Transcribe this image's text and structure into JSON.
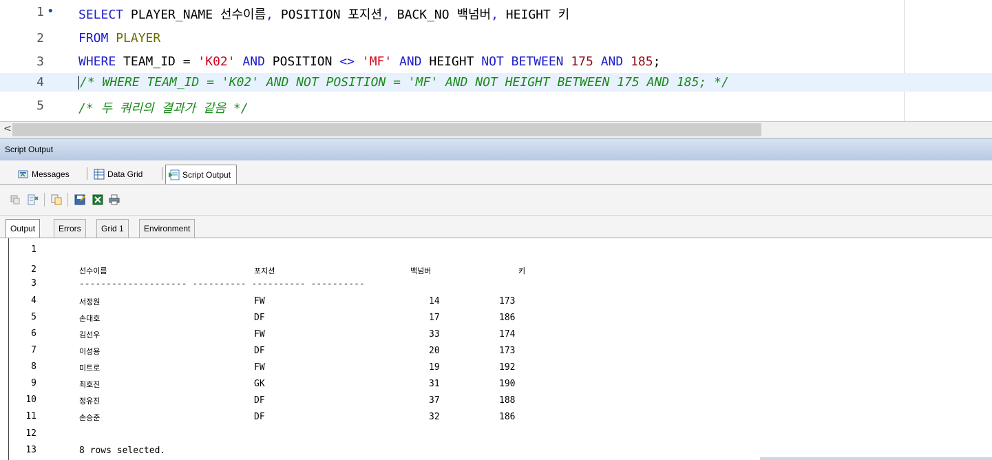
{
  "editor": {
    "lines": [
      {
        "num": "1",
        "marker": "•"
      },
      {
        "num": "2"
      },
      {
        "num": "3"
      },
      {
        "num": "4"
      },
      {
        "num": "5"
      }
    ],
    "line1": {
      "t1": "SELECT",
      "t2": " PLAYER_NAME 선수이름",
      "t3": ",",
      "t4": " POSITION 포지션",
      "t5": ",",
      "t6": " BACK_NO 백넘버",
      "t7": ",",
      "t8": " HEIGHT 키"
    },
    "line2": {
      "t1": "FROM",
      "t2": " PLAYER"
    },
    "line3": {
      "t1": "WHERE",
      "t2": " TEAM_ID = ",
      "t3": "'K02'",
      "t4": " AND",
      "t5": " POSITION ",
      "t6": "<>",
      "t7": " ",
      "t8": "'MF'",
      "t9": " AND",
      "t10": " HEIGHT ",
      "t11": "NOT BETWEEN",
      "t12": " ",
      "t13": "175",
      "t14": " AND",
      "t15": " ",
      "t16": "185",
      "t17": ";"
    },
    "line4": "/* WHERE TEAM_ID = 'K02' AND NOT POSITION = 'MF' AND NOT HEIGHT BETWEEN 175 AND 185; */",
    "line5": "/* 두 쿼리의 결과가 같음 */"
  },
  "scroll_left_arrow": "<",
  "panel": {
    "title": "Script Output"
  },
  "result_tabs": [
    {
      "label": "Messages",
      "icon": "messages-icon"
    },
    {
      "label": "Data Grid",
      "icon": "data-grid-icon"
    },
    {
      "label": "Script Output",
      "icon": "script-output-icon",
      "active": true
    }
  ],
  "toolbar_icons": [
    "pin-icon",
    "clear-icon",
    "copy-icon",
    "save-icon",
    "excel-icon",
    "print-icon"
  ],
  "output_tabs": [
    {
      "label": "Output",
      "active": true
    },
    {
      "label": "Errors"
    },
    {
      "label": "Grid 1"
    },
    {
      "label": "Environment"
    }
  ],
  "output": {
    "line_numbers": [
      "1",
      "2",
      "3",
      "4",
      "5",
      "6",
      "7",
      "8",
      "9",
      "10",
      "11",
      "12",
      "13"
    ],
    "headers": {
      "name": "선수이름",
      "position": "포지션",
      "back_no": "백넘버",
      "height": "키"
    },
    "separator": "-------------------- ---------- ---------- ----------",
    "rows": [
      {
        "name": "서정원",
        "position": "FW",
        "back_no": "14",
        "height": "173"
      },
      {
        "name": "손대호",
        "position": "DF",
        "back_no": "17",
        "height": "186"
      },
      {
        "name": "김선우",
        "position": "FW",
        "back_no": "33",
        "height": "174"
      },
      {
        "name": "이성용",
        "position": "DF",
        "back_no": "20",
        "height": "173"
      },
      {
        "name": "미트로",
        "position": "FW",
        "back_no": "19",
        "height": "192"
      },
      {
        "name": "최호진",
        "position": "GK",
        "back_no": "31",
        "height": "190"
      },
      {
        "name": "정유진",
        "position": "DF",
        "back_no": "37",
        "height": "188"
      },
      {
        "name": "손승준",
        "position": "DF",
        "back_no": "32",
        "height": "186"
      }
    ],
    "footer": "8 rows selected."
  }
}
